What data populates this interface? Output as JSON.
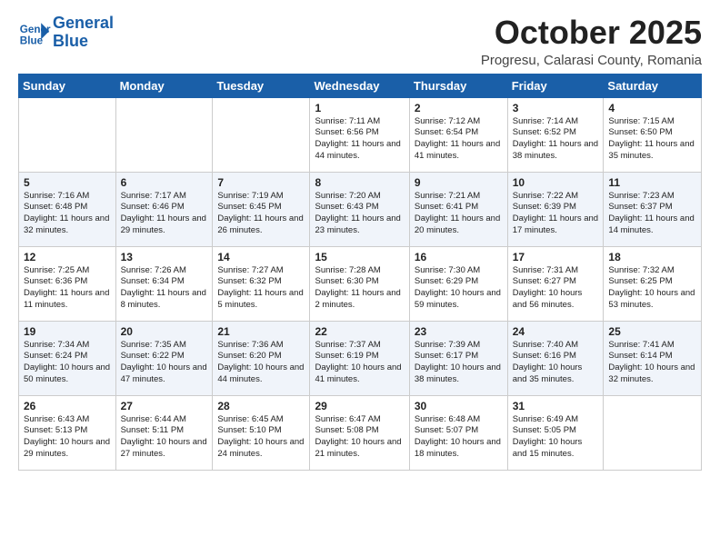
{
  "header": {
    "logo_line1": "General",
    "logo_line2": "Blue",
    "month": "October 2025",
    "location": "Progresu, Calarasi County, Romania"
  },
  "weekdays": [
    "Sunday",
    "Monday",
    "Tuesday",
    "Wednesday",
    "Thursday",
    "Friday",
    "Saturday"
  ],
  "weeks": [
    [
      {
        "day": "",
        "text": ""
      },
      {
        "day": "",
        "text": ""
      },
      {
        "day": "",
        "text": ""
      },
      {
        "day": "1",
        "text": "Sunrise: 7:11 AM\nSunset: 6:56 PM\nDaylight: 11 hours and 44 minutes."
      },
      {
        "day": "2",
        "text": "Sunrise: 7:12 AM\nSunset: 6:54 PM\nDaylight: 11 hours and 41 minutes."
      },
      {
        "day": "3",
        "text": "Sunrise: 7:14 AM\nSunset: 6:52 PM\nDaylight: 11 hours and 38 minutes."
      },
      {
        "day": "4",
        "text": "Sunrise: 7:15 AM\nSunset: 6:50 PM\nDaylight: 11 hours and 35 minutes."
      }
    ],
    [
      {
        "day": "5",
        "text": "Sunrise: 7:16 AM\nSunset: 6:48 PM\nDaylight: 11 hours and 32 minutes."
      },
      {
        "day": "6",
        "text": "Sunrise: 7:17 AM\nSunset: 6:46 PM\nDaylight: 11 hours and 29 minutes."
      },
      {
        "day": "7",
        "text": "Sunrise: 7:19 AM\nSunset: 6:45 PM\nDaylight: 11 hours and 26 minutes."
      },
      {
        "day": "8",
        "text": "Sunrise: 7:20 AM\nSunset: 6:43 PM\nDaylight: 11 hours and 23 minutes."
      },
      {
        "day": "9",
        "text": "Sunrise: 7:21 AM\nSunset: 6:41 PM\nDaylight: 11 hours and 20 minutes."
      },
      {
        "day": "10",
        "text": "Sunrise: 7:22 AM\nSunset: 6:39 PM\nDaylight: 11 hours and 17 minutes."
      },
      {
        "day": "11",
        "text": "Sunrise: 7:23 AM\nSunset: 6:37 PM\nDaylight: 11 hours and 14 minutes."
      }
    ],
    [
      {
        "day": "12",
        "text": "Sunrise: 7:25 AM\nSunset: 6:36 PM\nDaylight: 11 hours and 11 minutes."
      },
      {
        "day": "13",
        "text": "Sunrise: 7:26 AM\nSunset: 6:34 PM\nDaylight: 11 hours and 8 minutes."
      },
      {
        "day": "14",
        "text": "Sunrise: 7:27 AM\nSunset: 6:32 PM\nDaylight: 11 hours and 5 minutes."
      },
      {
        "day": "15",
        "text": "Sunrise: 7:28 AM\nSunset: 6:30 PM\nDaylight: 11 hours and 2 minutes."
      },
      {
        "day": "16",
        "text": "Sunrise: 7:30 AM\nSunset: 6:29 PM\nDaylight: 10 hours and 59 minutes."
      },
      {
        "day": "17",
        "text": "Sunrise: 7:31 AM\nSunset: 6:27 PM\nDaylight: 10 hours and 56 minutes."
      },
      {
        "day": "18",
        "text": "Sunrise: 7:32 AM\nSunset: 6:25 PM\nDaylight: 10 hours and 53 minutes."
      }
    ],
    [
      {
        "day": "19",
        "text": "Sunrise: 7:34 AM\nSunset: 6:24 PM\nDaylight: 10 hours and 50 minutes."
      },
      {
        "day": "20",
        "text": "Sunrise: 7:35 AM\nSunset: 6:22 PM\nDaylight: 10 hours and 47 minutes."
      },
      {
        "day": "21",
        "text": "Sunrise: 7:36 AM\nSunset: 6:20 PM\nDaylight: 10 hours and 44 minutes."
      },
      {
        "day": "22",
        "text": "Sunrise: 7:37 AM\nSunset: 6:19 PM\nDaylight: 10 hours and 41 minutes."
      },
      {
        "day": "23",
        "text": "Sunrise: 7:39 AM\nSunset: 6:17 PM\nDaylight: 10 hours and 38 minutes."
      },
      {
        "day": "24",
        "text": "Sunrise: 7:40 AM\nSunset: 6:16 PM\nDaylight: 10 hours and 35 minutes."
      },
      {
        "day": "25",
        "text": "Sunrise: 7:41 AM\nSunset: 6:14 PM\nDaylight: 10 hours and 32 minutes."
      }
    ],
    [
      {
        "day": "26",
        "text": "Sunrise: 6:43 AM\nSunset: 5:13 PM\nDaylight: 10 hours and 29 minutes."
      },
      {
        "day": "27",
        "text": "Sunrise: 6:44 AM\nSunset: 5:11 PM\nDaylight: 10 hours and 27 minutes."
      },
      {
        "day": "28",
        "text": "Sunrise: 6:45 AM\nSunset: 5:10 PM\nDaylight: 10 hours and 24 minutes."
      },
      {
        "day": "29",
        "text": "Sunrise: 6:47 AM\nSunset: 5:08 PM\nDaylight: 10 hours and 21 minutes."
      },
      {
        "day": "30",
        "text": "Sunrise: 6:48 AM\nSunset: 5:07 PM\nDaylight: 10 hours and 18 minutes."
      },
      {
        "day": "31",
        "text": "Sunrise: 6:49 AM\nSunset: 5:05 PM\nDaylight: 10 hours and 15 minutes."
      },
      {
        "day": "",
        "text": ""
      }
    ]
  ]
}
